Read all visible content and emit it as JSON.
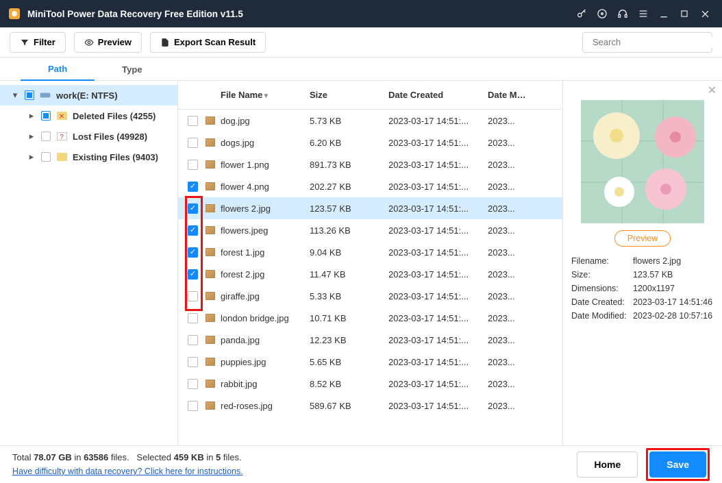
{
  "title": "MiniTool Power Data Recovery Free Edition v11.5",
  "toolbar": {
    "filter": "Filter",
    "preview": "Preview",
    "export": "Export Scan Result",
    "search_placeholder": "Search"
  },
  "tabs": {
    "path": "Path",
    "type": "Type"
  },
  "tree": {
    "root": "work(E: NTFS)",
    "deleted": "Deleted Files (4255)",
    "lost": "Lost Files (49928)",
    "existing": "Existing Files (9403)"
  },
  "columns": {
    "name": "File Name",
    "size": "Size",
    "created": "Date Created",
    "modified": "Date Modif"
  },
  "files": [
    {
      "checked": false,
      "name": "dog.jpg",
      "size": "5.73 KB",
      "created": "2023-03-17 14:51:...",
      "mod": "2023...",
      "sel": false
    },
    {
      "checked": false,
      "name": "dogs.jpg",
      "size": "6.20 KB",
      "created": "2023-03-17 14:51:...",
      "mod": "2023...",
      "sel": false
    },
    {
      "checked": false,
      "name": "flower 1.png",
      "size": "891.73 KB",
      "created": "2023-03-17 14:51:...",
      "mod": "2023...",
      "sel": false
    },
    {
      "checked": true,
      "name": "flower 4.png",
      "size": "202.27 KB",
      "created": "2023-03-17 14:51:...",
      "mod": "2023...",
      "sel": false
    },
    {
      "checked": true,
      "name": "flowers 2.jpg",
      "size": "123.57 KB",
      "created": "2023-03-17 14:51:...",
      "mod": "2023...",
      "sel": true
    },
    {
      "checked": true,
      "name": "flowers.jpeg",
      "size": "113.26 KB",
      "created": "2023-03-17 14:51:...",
      "mod": "2023...",
      "sel": false
    },
    {
      "checked": true,
      "name": "forest 1.jpg",
      "size": "9.04 KB",
      "created": "2023-03-17 14:51:...",
      "mod": "2023...",
      "sel": false
    },
    {
      "checked": true,
      "name": "forest 2.jpg",
      "size": "11.47 KB",
      "created": "2023-03-17 14:51:...",
      "mod": "2023...",
      "sel": false
    },
    {
      "checked": false,
      "name": "giraffe.jpg",
      "size": "5.33 KB",
      "created": "2023-03-17 14:51:...",
      "mod": "2023...",
      "sel": false
    },
    {
      "checked": false,
      "name": "london bridge.jpg",
      "size": "10.71 KB",
      "created": "2023-03-17 14:51:...",
      "mod": "2023...",
      "sel": false
    },
    {
      "checked": false,
      "name": "panda.jpg",
      "size": "12.23 KB",
      "created": "2023-03-17 14:51:...",
      "mod": "2023...",
      "sel": false
    },
    {
      "checked": false,
      "name": "puppies.jpg",
      "size": "5.65 KB",
      "created": "2023-03-17 14:51:...",
      "mod": "2023...",
      "sel": false
    },
    {
      "checked": false,
      "name": "rabbit.jpg",
      "size": "8.52 KB",
      "created": "2023-03-17 14:51:...",
      "mod": "2023...",
      "sel": false
    },
    {
      "checked": false,
      "name": "red-roses.jpg",
      "size": "589.67 KB",
      "created": "2023-03-17 14:51:...",
      "mod": "2023...",
      "sel": false
    }
  ],
  "preview": {
    "button": "Preview",
    "filename_label": "Filename:",
    "filename": "flowers 2.jpg",
    "size_label": "Size:",
    "size": "123.57 KB",
    "dim_label": "Dimensions:",
    "dim": "1200x1197",
    "created_label": "Date Created:",
    "created": "2023-03-17 14:51:46",
    "modified_label": "Date Modified:",
    "modified": "2023-02-28 10:57:16"
  },
  "footer": {
    "total_prefix": "Total ",
    "total_size": "78.07 GB",
    "total_mid": " in ",
    "total_files": "63586",
    "total_suffix": " files.",
    "sel_prefix": "Selected ",
    "sel_size": "459 KB",
    "sel_mid": " in ",
    "sel_count": "5",
    "sel_suffix": " files.",
    "help": "Have difficulty with data recovery? Click here for instructions.",
    "home": "Home",
    "save": "Save"
  }
}
